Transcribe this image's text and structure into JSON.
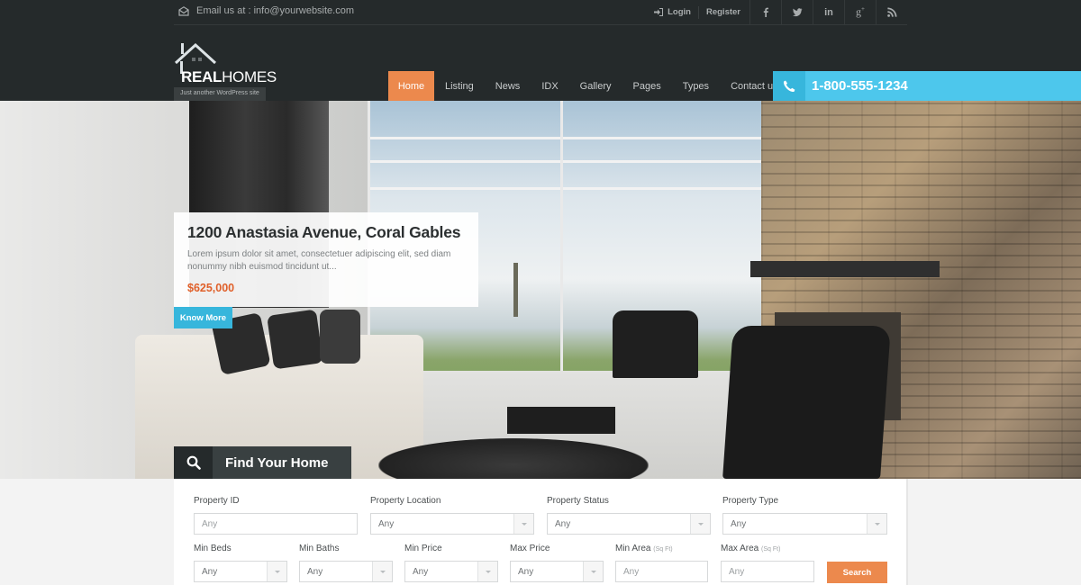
{
  "topbar": {
    "email_text": "Email us at : info@yourwebsite.com",
    "login_label": "Login",
    "register_label": "Register",
    "social": [
      {
        "name": "facebook",
        "glyph": "f"
      },
      {
        "name": "twitter",
        "glyph": "t"
      },
      {
        "name": "linkedin",
        "glyph": "in"
      },
      {
        "name": "google-plus",
        "glyph": "g+"
      },
      {
        "name": "rss",
        "glyph": "rss"
      }
    ]
  },
  "logo": {
    "brand_bold": "REAL",
    "brand_light": "HOMES",
    "tagline": "Just another WordPress site"
  },
  "nav": {
    "items": [
      {
        "label": "Home",
        "active": true
      },
      {
        "label": "Listing"
      },
      {
        "label": "News"
      },
      {
        "label": "IDX"
      },
      {
        "label": "Gallery"
      },
      {
        "label": "Pages"
      },
      {
        "label": "Types"
      },
      {
        "label": "Contact us"
      }
    ]
  },
  "phone": {
    "number": "1-800-555-1234"
  },
  "slide": {
    "title": "1200 Anastasia Avenue, Coral Gables",
    "description": "Lorem ipsum dolor sit amet, consectetuer adipiscing elit, sed diam nonummy nibh euismod tincidunt ut...",
    "price": "$625,000",
    "cta_label": "Know More"
  },
  "search": {
    "tab_label": "Find Your Home",
    "fields": {
      "property_id": {
        "label": "Property ID",
        "placeholder": "Any"
      },
      "property_location": {
        "label": "Property Location",
        "value": "Any"
      },
      "property_status": {
        "label": "Property Status",
        "value": "Any"
      },
      "property_type": {
        "label": "Property Type",
        "value": "Any"
      },
      "min_beds": {
        "label": "Min Beds",
        "value": "Any"
      },
      "min_baths": {
        "label": "Min Baths",
        "value": "Any"
      },
      "min_price": {
        "label": "Min Price",
        "value": "Any"
      },
      "max_price": {
        "label": "Max Price",
        "value": "Any"
      },
      "min_area": {
        "label": "Min Area",
        "unit": "(Sq Ft)",
        "placeholder": "Any"
      },
      "max_area": {
        "label": "Max Area",
        "unit": "(Sq Ft)",
        "placeholder": "Any"
      }
    },
    "button_label": "Search"
  },
  "colors": {
    "header_bg": "#252a2b",
    "accent_orange": "#ec894d",
    "accent_blue": "#4dc7ec",
    "price_red": "#e0602a"
  }
}
